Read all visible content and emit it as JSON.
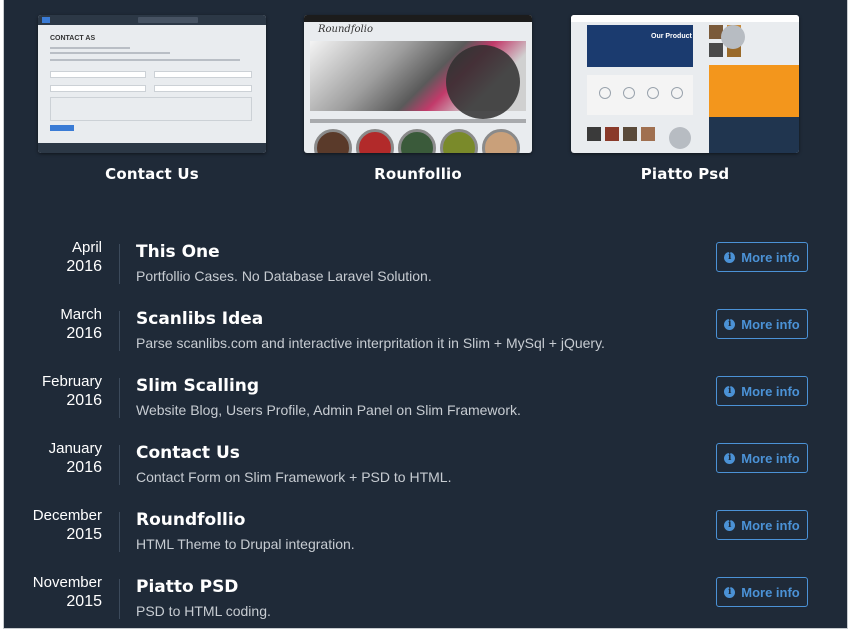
{
  "portfolio": {
    "cards": [
      {
        "title": "Contact Us",
        "thumb_heading": "CONTACT AS"
      },
      {
        "title": "Rounfollio",
        "thumb_brand": "Roundfolio"
      },
      {
        "title": "Piatto Psd",
        "thumb_heading": "Our Product"
      }
    ]
  },
  "timeline": {
    "button_label": "More info",
    "button_icon": "info-icon",
    "accent_color": "#4b92d6",
    "items": [
      {
        "month": "April",
        "year": "2016",
        "title": "This One",
        "description": "Portfollio Cases. No Database Laravel Solution."
      },
      {
        "month": "March",
        "year": "2016",
        "title": "Scanlibs Idea",
        "description": "Parse scanlibs.com and interactive interpritation it in Slim + MySql + jQuery."
      },
      {
        "month": "February",
        "year": "2016",
        "title": "Slim Scalling",
        "description": "Website Blog, Users Profile, Admin Panel on Slim Framework."
      },
      {
        "month": "January",
        "year": "2016",
        "title": "Contact Us",
        "description": "Contact Form on Slim Framework + PSD to HTML."
      },
      {
        "month": "December",
        "year": "2015",
        "title": "Roundfollio",
        "description": "HTML Theme to Drupal integration."
      },
      {
        "month": "November",
        "year": "2015",
        "title": "Piatto PSD",
        "description": "PSD to HTML coding."
      }
    ]
  }
}
